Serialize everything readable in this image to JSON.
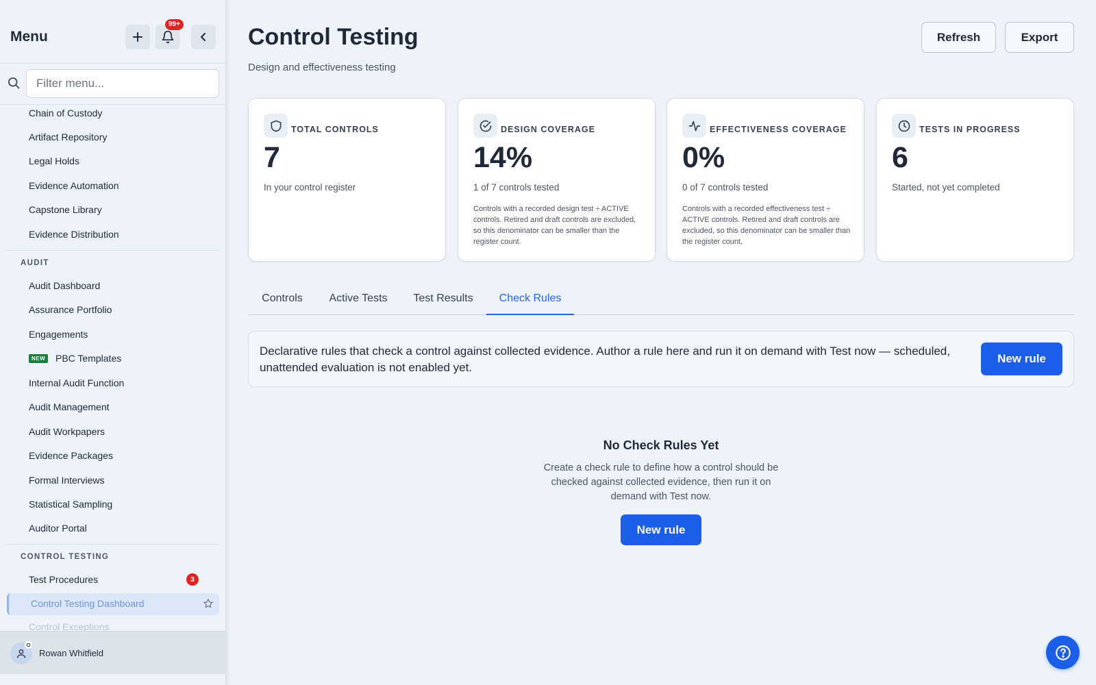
{
  "sidebar": {
    "title": "Menu",
    "notification_count": "99+",
    "search": {
      "placeholder": "Filter menu...",
      "value": ""
    },
    "items_top": [
      "Chain of Custody",
      "Artifact Repository",
      "Legal Holds",
      "Evidence Automation",
      "Capstone Library",
      "Evidence Distribution"
    ],
    "audit_section": {
      "label": "AUDIT",
      "items": [
        "Audit Dashboard",
        "Assurance Portfolio",
        "Engagements",
        "PBC Templates",
        "Internal Audit Function",
        "Audit Management",
        "Audit Workpapers",
        "Evidence Packages",
        "Formal Interviews",
        "Statistical Sampling",
        "Auditor Portal"
      ],
      "new_badge": "NEW"
    },
    "control_testing_section": {
      "label": "CONTROL TESTING",
      "items": [
        {
          "label": "Test Procedures",
          "badge": "3"
        },
        {
          "label": "Control Testing Dashboard",
          "active": true
        },
        {
          "label": "Control Exceptions"
        }
      ]
    },
    "user": {
      "name": "Rowan Whitfield"
    }
  },
  "page": {
    "title": "Control Testing",
    "subtitle": "Design and effectiveness testing",
    "refresh_label": "Refresh",
    "export_label": "Export"
  },
  "stats": [
    {
      "icon": "shield-icon",
      "label": "TOTAL CONTROLS",
      "value": "7",
      "sub": "In your control register",
      "note": ""
    },
    {
      "icon": "check-circle-icon",
      "label": "DESIGN COVERAGE",
      "value": "14%",
      "sub": "1 of 7 controls tested",
      "note": "Controls with a recorded design test ÷ ACTIVE controls. Retired and draft controls are excluded, so this denominator can be smaller than the register count."
    },
    {
      "icon": "activity-icon",
      "label": "EFFECTIVENESS COVERAGE",
      "value": "0%",
      "sub": "0 of 7 controls tested",
      "note": "Controls with a recorded effectiveness test ÷ ACTIVE controls. Retired and draft controls are excluded, so this denominator can be smaller than the register count."
    },
    {
      "icon": "clock-icon",
      "label": "TESTS IN PROGRESS",
      "value": "6",
      "sub": "Started, not yet completed",
      "note": ""
    }
  ],
  "tabs": [
    {
      "label": "Controls"
    },
    {
      "label": "Active Tests"
    },
    {
      "label": "Test Results"
    },
    {
      "label": "Check Rules",
      "active": true
    }
  ],
  "info": {
    "text": "Declarative rules that check a control against collected evidence. Author a rule here and run it on demand with Test now — scheduled, unattended evaluation is not enabled yet.",
    "button_label": "New rule"
  },
  "empty_state": {
    "title": "No Check Rules Yet",
    "text": "Create a check rule to define how a control should be checked against collected evidence, then run it on demand with Test now.",
    "button_label": "New rule"
  },
  "colors": {
    "accent": "#1d5ee8",
    "danger": "#dc2626",
    "new_badge": "#15803d"
  }
}
